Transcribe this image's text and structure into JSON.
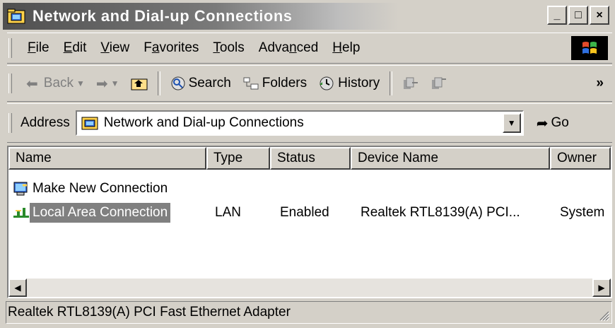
{
  "window": {
    "title": "Network and Dial-up Connections",
    "controls": {
      "minimize": "_",
      "maximize": "□",
      "close": "×"
    }
  },
  "menu": {
    "items": [
      "File",
      "Edit",
      "View",
      "Favorites",
      "Tools",
      "Advanced",
      "Help"
    ],
    "accel": [
      "F",
      "E",
      "V",
      "a",
      "T",
      "n",
      "H"
    ]
  },
  "toolbar": {
    "back": "Back",
    "search": "Search",
    "folders": "Folders",
    "history": "History",
    "more": "»"
  },
  "address": {
    "label": "Address",
    "value": "Network and Dial-up Connections",
    "go": "Go"
  },
  "list": {
    "columns": [
      "Name",
      "Type",
      "Status",
      "Device Name",
      "Owner"
    ],
    "rows": [
      {
        "name": "Make New Connection",
        "type": "",
        "status": "",
        "device": "",
        "owner": "",
        "icon": "make-new-connection-icon"
      },
      {
        "name": "Local Area Connection",
        "type": "LAN",
        "status": "Enabled",
        "device": "Realtek RTL8139(A) PCI...",
        "owner": "System",
        "icon": "lan-connection-icon",
        "selected": true
      }
    ]
  },
  "status": {
    "text": "Realtek RTL8139(A) PCI Fast Ethernet Adapter"
  },
  "colors": {
    "selection": "#808080",
    "face": "#d4d0c8",
    "title_dark": "#4f4f4f"
  }
}
